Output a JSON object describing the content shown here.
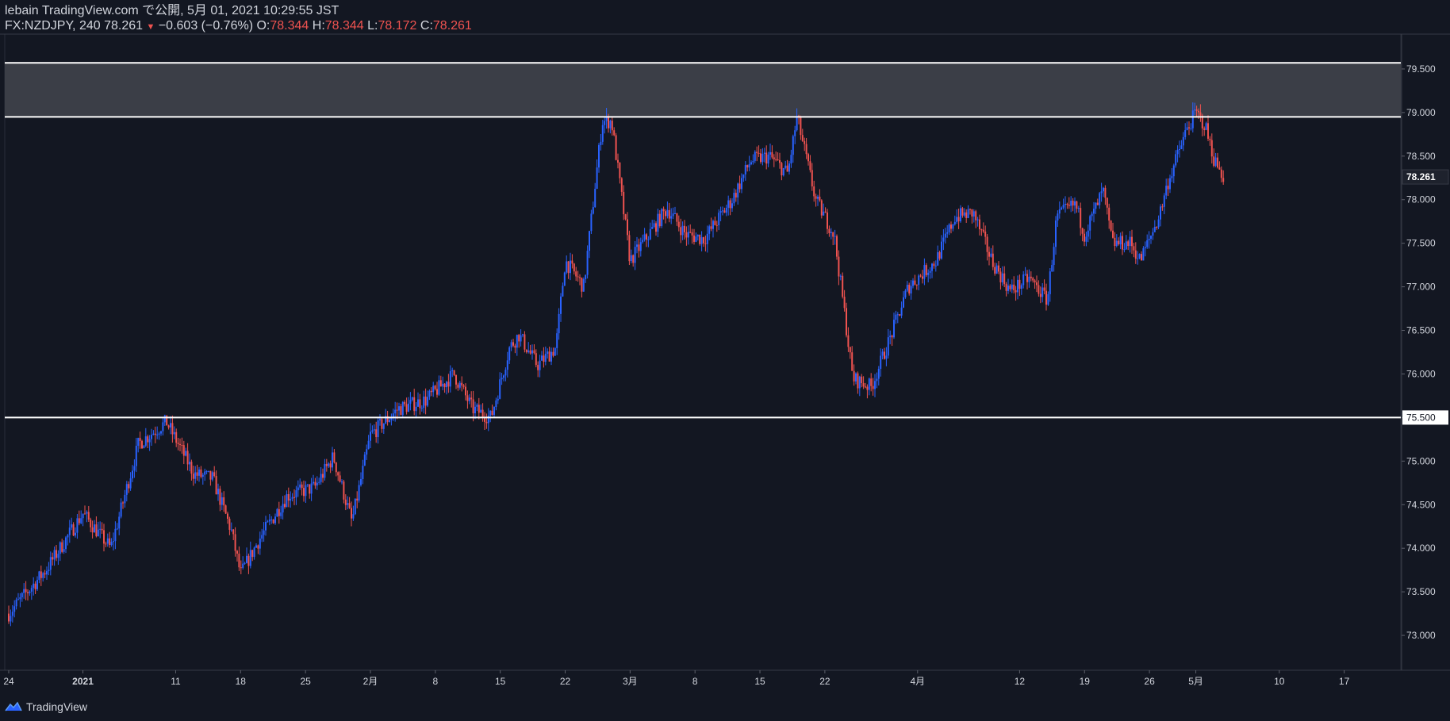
{
  "header": {
    "publish_line": "lebain TradingView.com で公開, 5月 01, 2021 10:29:55 JST",
    "symbol": "FX:NZDJPY, 240",
    "last": "78.261",
    "down_arrow": "▼",
    "change": "−0.603 (−0.76%)",
    "o_label": "O:",
    "o_value": "78.344",
    "h_label": "H:",
    "h_value": "78.344",
    "l_label": "L:",
    "l_value": "78.172",
    "c_label": "C:",
    "c_value": "78.261"
  },
  "footer": {
    "brand": "TradingView"
  },
  "colors": {
    "background": "#131722",
    "up": "#2962ff",
    "down": "#ef5350",
    "grid": "#2a2e39",
    "zone": "#3b3e47",
    "level_line": "#ffffff",
    "text": "#d1d4dc"
  },
  "chart_data": {
    "type": "candlestick",
    "symbol": "FX:NZDJPY",
    "timeframe": "240",
    "ylim": [
      72.6,
      79.9
    ],
    "price_ticks": [
      "73.000",
      "73.500",
      "74.000",
      "74.500",
      "75.000",
      "75.500",
      "76.000",
      "76.500",
      "77.000",
      "77.500",
      "78.000",
      "78.500",
      "79.000",
      "79.500"
    ],
    "x_ticks": [
      "24",
      "2021",
      "11",
      "18",
      "25",
      "2月",
      "8",
      "15",
      "22",
      "3月",
      "8",
      "15",
      "22",
      "4月",
      "12",
      "19",
      "26",
      "5月",
      "10",
      "17"
    ],
    "last_price_label": "78.261",
    "marked_level_label": "75.500",
    "zone": {
      "lower": 78.95,
      "upper": 79.57
    },
    "horizontal_lines": [
      79.57,
      78.95,
      75.5
    ],
    "series": [
      {
        "x": "2020-12-24",
        "y": 73.25
      },
      {
        "x": "2020-12-28",
        "y": 73.75
      },
      {
        "x": "2021-01-01",
        "y": 74.4
      },
      {
        "x": "2021-01-04",
        "y": 74.0
      },
      {
        "x": "2021-01-07",
        "y": 75.2
      },
      {
        "x": "2021-01-10",
        "y": 75.45
      },
      {
        "x": "2021-01-13",
        "y": 74.85
      },
      {
        "x": "2021-01-15",
        "y": 74.8
      },
      {
        "x": "2021-01-17",
        "y": 74.2
      },
      {
        "x": "2021-01-18",
        "y": 73.7
      },
      {
        "x": "2021-01-20",
        "y": 74.1
      },
      {
        "x": "2021-01-23",
        "y": 74.6
      },
      {
        "x": "2021-01-26",
        "y": 74.7
      },
      {
        "x": "2021-01-28",
        "y": 75.05
      },
      {
        "x": "2021-01-30",
        "y": 74.3
      },
      {
        "x": "2021-02-01",
        "y": 75.3
      },
      {
        "x": "2021-02-04",
        "y": 75.6
      },
      {
        "x": "2021-02-07",
        "y": 75.7
      },
      {
        "x": "2021-02-10",
        "y": 76.0
      },
      {
        "x": "2021-02-12",
        "y": 75.6
      },
      {
        "x": "2021-02-14",
        "y": 75.5
      },
      {
        "x": "2021-02-16",
        "y": 76.3
      },
      {
        "x": "2021-02-17",
        "y": 76.45
      },
      {
        "x": "2021-02-19",
        "y": 76.1
      },
      {
        "x": "2021-02-21",
        "y": 76.3
      },
      {
        "x": "2021-02-22",
        "y": 77.3
      },
      {
        "x": "2021-02-24",
        "y": 77.0
      },
      {
        "x": "2021-02-26",
        "y": 78.9
      },
      {
        "x": "2021-02-27",
        "y": 78.9
      },
      {
        "x": "2021-03-01",
        "y": 77.3
      },
      {
        "x": "2021-03-03",
        "y": 77.6
      },
      {
        "x": "2021-03-05",
        "y": 77.9
      },
      {
        "x": "2021-03-07",
        "y": 77.6
      },
      {
        "x": "2021-03-09",
        "y": 77.55
      },
      {
        "x": "2021-03-12",
        "y": 78.0
      },
      {
        "x": "2021-03-14",
        "y": 78.45
      },
      {
        "x": "2021-03-16",
        "y": 78.5
      },
      {
        "x": "2021-03-18",
        "y": 78.3
      },
      {
        "x": "2021-03-19",
        "y": 78.95
      },
      {
        "x": "2021-03-21",
        "y": 78.0
      },
      {
        "x": "2021-03-23",
        "y": 77.6
      },
      {
        "x": "2021-03-24",
        "y": 76.8
      },
      {
        "x": "2021-03-25",
        "y": 75.95
      },
      {
        "x": "2021-03-27",
        "y": 75.85
      },
      {
        "x": "2021-03-29",
        "y": 76.4
      },
      {
        "x": "2021-03-31",
        "y": 77.0
      },
      {
        "x": "2021-04-03",
        "y": 77.3
      },
      {
        "x": "2021-04-05",
        "y": 77.8
      },
      {
        "x": "2021-04-07",
        "y": 77.85
      },
      {
        "x": "2021-04-09",
        "y": 77.3
      },
      {
        "x": "2021-04-11",
        "y": 76.95
      },
      {
        "x": "2021-04-13",
        "y": 77.1
      },
      {
        "x": "2021-04-15",
        "y": 76.85
      },
      {
        "x": "2021-04-16",
        "y": 77.8
      },
      {
        "x": "2021-04-18",
        "y": 77.95
      },
      {
        "x": "2021-04-19",
        "y": 77.6
      },
      {
        "x": "2021-04-21",
        "y": 78.1
      },
      {
        "x": "2021-04-22",
        "y": 77.5
      },
      {
        "x": "2021-04-24",
        "y": 77.5
      },
      {
        "x": "2021-04-25",
        "y": 77.3
      },
      {
        "x": "2021-04-27",
        "y": 77.8
      },
      {
        "x": "2021-04-28",
        "y": 78.2
      },
      {
        "x": "2021-04-30",
        "y": 78.8
      },
      {
        "x": "2021-05-01",
        "y": 79.0
      },
      {
        "x": "2021-05-02",
        "y": 78.85
      },
      {
        "x": "2021-05-03",
        "y": 78.45
      },
      {
        "x": "2021-05-04",
        "y": 78.261
      }
    ]
  }
}
